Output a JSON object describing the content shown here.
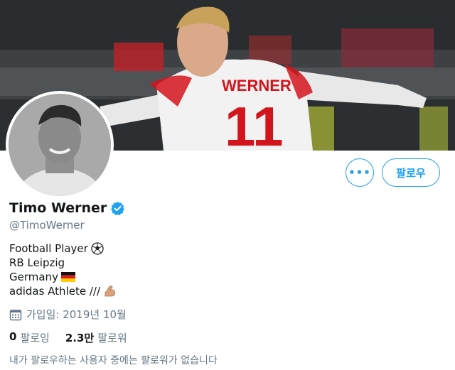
{
  "profile": {
    "display_name": "Timo Werner",
    "handle": "@TimoWerner",
    "verified": true,
    "jersey_name": "WERNER",
    "jersey_number": "11"
  },
  "actions": {
    "more_label": "•••",
    "follow_label": "팔로우"
  },
  "bio": {
    "lines": [
      "Football Player",
      "RB Leipzig",
      "Germany",
      "adidas Athlete ///"
    ],
    "emoji_icons": [
      "soccer-ball-icon",
      "german-flag-icon",
      "flexed-biceps-icon"
    ]
  },
  "joined": "가입일: 2019년 10월",
  "stats": {
    "following_count": "0",
    "following_label": "팔로잉",
    "followers_count": "2.3만",
    "followers_label": "팔로워"
  },
  "footnote": "내가 팔로우하는 사용자 중에는 팔로워가 없습니다",
  "colors": {
    "accent": "#1da1f2",
    "secondary_text": "#657786",
    "primary_text": "#14171a",
    "jersey_red": "#d4141c"
  }
}
